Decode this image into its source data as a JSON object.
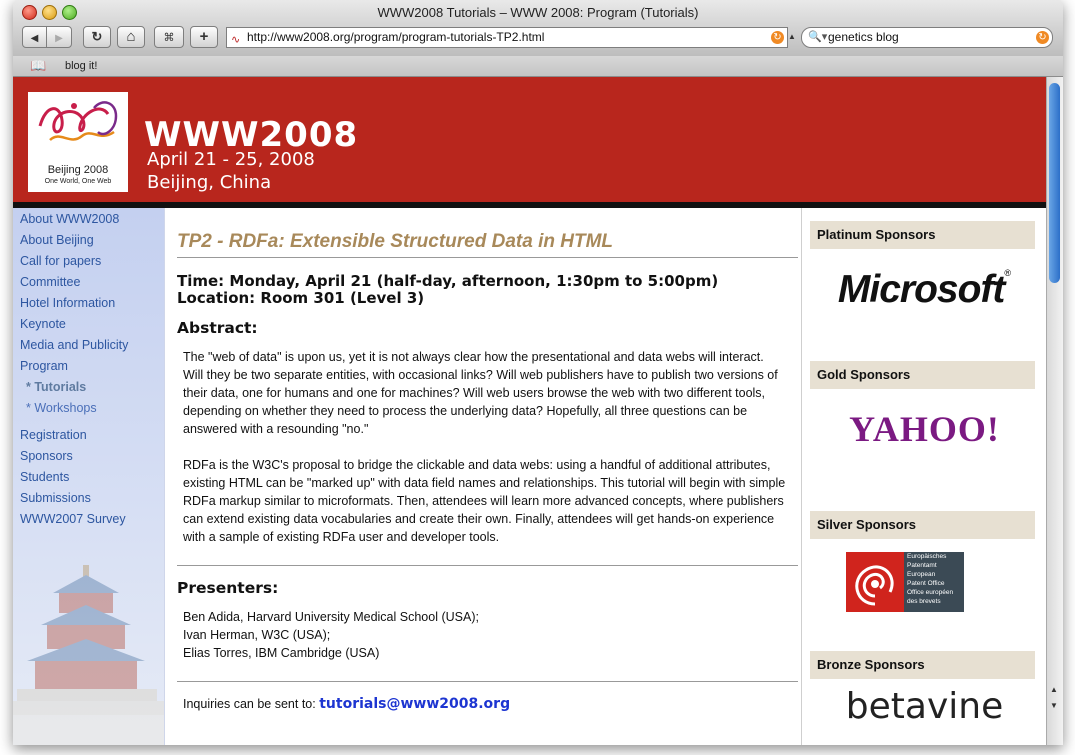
{
  "browser": {
    "window_title": "WWW2008 Tutorials – WWW 2008: Program (Tutorials)",
    "back_icon": "◀",
    "forward_icon": "▶",
    "reload_icon": "↻",
    "home_icon": "⌂",
    "snapback_icon": "⌘",
    "add_icon": "+",
    "url": "http://www2008.org/program/program-tutorials-TP2.html",
    "search_value": "genetics blog",
    "bookmark_icon": "📖",
    "bookmark_label": "blog it!"
  },
  "banner": {
    "logo_line1": "Beijing 2008",
    "logo_line2": "One World, One Web",
    "title": "WWW2008",
    "dates": "April 21 - 25, 2008",
    "location": "Beijing, China"
  },
  "nav": {
    "items": [
      "About WWW2008",
      "About Beijing",
      "Call for papers",
      "Committee",
      "Hotel Information",
      "Keynote",
      "Media and Publicity",
      "Program"
    ],
    "sub_items": [
      "* Tutorials",
      "* Workshops"
    ],
    "items2": [
      "Registration",
      "Sponsors",
      "Students",
      "Submissions",
      "WWW2007 Survey"
    ]
  },
  "main": {
    "heading": "TP2 - RDFa: Extensible Structured Data in HTML",
    "time": "Time: Monday, April 21 (half-day, afternoon, 1:30pm to 5:00pm)",
    "location": "Location: Room 301 (Level 3)",
    "abstract_heading": "Abstract:",
    "abstract_p1": "The \"web of data\" is upon us, yet it is not always clear how the presentational and data webs will interact. Will they be two separate entities, with occasional links? Will web publishers have to publish two versions of their data, one for humans and one for machines? Will web users browse the web with two different tools, depending on whether they need to process the underlying data? Hopefully, all three questions can be answered with a resounding \"no.\"",
    "abstract_p2": "RDFa is the W3C's proposal to bridge the clickable and data webs: using a handful of additional attributes, existing HTML can be \"marked up\" with data field names and relationships. This tutorial will begin with simple RDFa markup similar to microformats. Then, attendees will learn more advanced concepts, where publishers can extend existing data vocabularies and create their own. Finally, attendees will get hands-on experience with a sample of existing RDFa user and developer tools.",
    "presenters_heading": "Presenters:",
    "presenters": [
      "Ben Adida, Harvard University Medical School (USA);",
      "Ivan Herman, W3C (USA);",
      "Elias Torres, IBM Cambridge (USA)"
    ],
    "inquiries_label": "Inquiries can be sent to:",
    "inquiries_email": "tutorials@www2008.org"
  },
  "sponsors": {
    "platinum_heading": "Platinum Sponsors",
    "platinum_logo": "Microsoft",
    "platinum_mark": "®",
    "gold_heading": "Gold Sponsors",
    "gold_logo": "YAHOO!",
    "silver_heading": "Silver Sponsors",
    "silver_logo_lines": [
      "Europäisches",
      "Patentamt",
      "European",
      "Patent Office",
      "Office européen",
      "des brevets"
    ],
    "bronze_heading": "Bronze Sponsors",
    "bronze_logo": "betavine"
  },
  "colors": {
    "banner": "#b8261d",
    "heading": "#a8895a",
    "nav_link": "#2d56a0",
    "sponsor_header": "#e7e0d2",
    "email": "#1d35d1"
  }
}
